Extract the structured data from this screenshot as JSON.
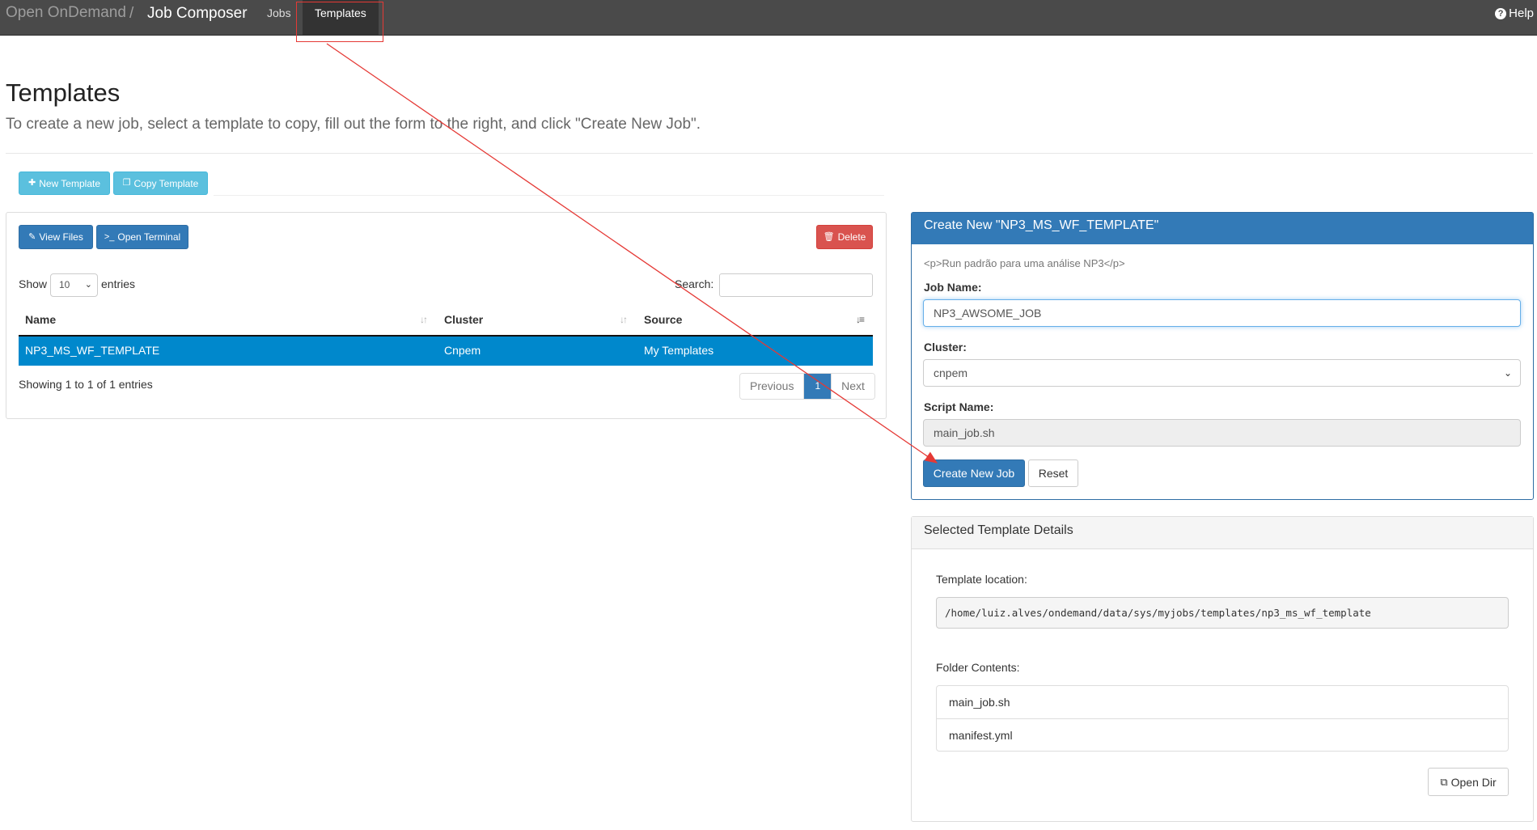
{
  "navbar": {
    "brand": "Open OnDemand",
    "separator": "/",
    "app_name": "Job Composer",
    "nav_jobs": "Jobs",
    "nav_templates": "Templates",
    "help": "Help"
  },
  "header": {
    "title": "Templates",
    "subtitle": "To create a new job, select a template to copy, fill out the form to the right, and click \"Create New Job\"."
  },
  "toolbar": {
    "new_template": "New Template",
    "copy_template": "Copy Template"
  },
  "panel_left": {
    "view_files": "View Files",
    "open_terminal": "Open Terminal",
    "delete": "Delete",
    "show": "Show",
    "entries_value": "10",
    "entries": "entries",
    "search_label": "Search:",
    "columns": [
      "Name",
      "Cluster",
      "Source"
    ],
    "rows": [
      {
        "name": "NP3_MS_WF_TEMPLATE",
        "cluster": "Cnpem",
        "source": "My Templates"
      }
    ],
    "showing": "Showing 1 to 1 of 1 entries",
    "pager": {
      "previous": "Previous",
      "page": "1",
      "next": "Next"
    }
  },
  "create_panel": {
    "title": "Create New \"NP3_MS_WF_TEMPLATE\"",
    "description": "<p>Run padrão para uma análise NP3</p>",
    "job_name_label": "Job Name:",
    "job_name_value": "NP3_AWSOME_JOB",
    "cluster_label": "Cluster:",
    "cluster_value": "cnpem",
    "script_label": "Script Name:",
    "script_value": "main_job.sh",
    "create_button": "Create New Job",
    "reset_button": "Reset"
  },
  "details_panel": {
    "title": "Selected Template Details",
    "location_label": "Template location:",
    "location_value": "/home/luiz.alves/ondemand/data/sys/myjobs/templates/np3_ms_wf_template",
    "folder_label": "Folder Contents:",
    "folder_items": [
      "main_job.sh",
      "manifest.yml"
    ],
    "open_dir": "Open Dir"
  },
  "colors": {
    "navbar": "#4a4a4a",
    "primary": "#337ab7",
    "info": "#5bc0de",
    "danger": "#d9534f",
    "selected_row": "#0088cc",
    "annotation": "#e53935"
  },
  "icons": [
    "plus-icon",
    "copy-icon",
    "edit-icon",
    "terminal-icon",
    "trash-icon",
    "sort-icon",
    "sort-asc-icon",
    "chevron-down-icon",
    "external-link-icon",
    "question-circle-icon"
  ]
}
